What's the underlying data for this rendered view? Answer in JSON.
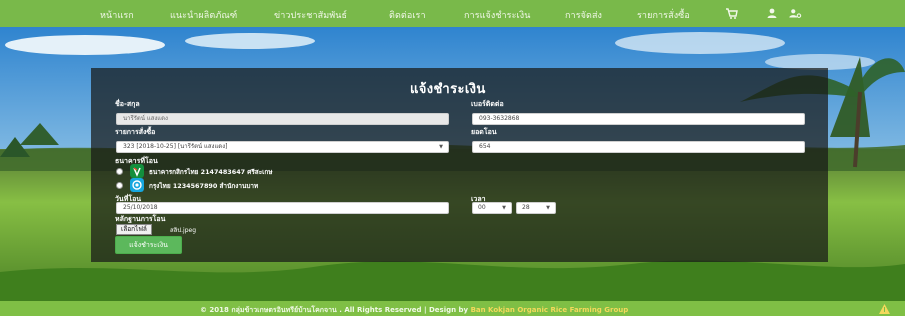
{
  "nav": {
    "items": [
      "หน้าแรก",
      "แนะนำผลิตภัณฑ์",
      "ข่าวประชาสัมพันธ์",
      "ติดต่อเรา",
      "การแจ้งชำระเงิน",
      "การจัดส่ง",
      "รายการสั่งซื้อ"
    ],
    "icons": [
      "cart-icon",
      "user-icon",
      "user-gear-icon"
    ]
  },
  "form": {
    "title": "แจ้งชำระเงิน",
    "name_label": "ชื่อ-สกุล",
    "name_value": "นารีรัตน์ แสงแดง",
    "phone_label": "เบอร์ติดต่อ",
    "phone_value": "093-3632868",
    "order_label": "รายการสั่งซื้อ",
    "order_value": "323 [2018-10-25] [นารีรัตน์ แสงแดง]",
    "amount_label": "ยอดโอน",
    "amount_value": "654",
    "bank_label": "ธนาคารที่โอน",
    "banks": [
      {
        "name": "ธนาคารกสิกรไทย 2147483647 ศรีสะเกษ",
        "icon": "kasikorn-bank-icon"
      },
      {
        "name": "กรุงไทย 1234567890 สำนักงานบาท",
        "icon": "krungthai-bank-icon"
      }
    ],
    "date_label": "วันที่โอน",
    "date_value": "25/10/2018",
    "time_label": "เวลา",
    "hour_value": "00",
    "minute_value": "28",
    "proof_label": "หลักฐานการโอน",
    "file_button": "เลือกไฟล์",
    "file_name": "สลิป.jpeg",
    "submit": "แจ้งชำระเงิน"
  },
  "footer": {
    "text": "© 2018 กลุ่มข้าวเกษตรอินทรีย์บ้านโคกจาน . All Rights Reserved | Design by",
    "highlight": "Ban Kokjan Organic Rice Farming Group"
  },
  "colors": {
    "nav": "#79b94a",
    "panel": "#171918",
    "submit": "#5cb85c",
    "footer": "#7fbf45",
    "footer_highlight": "#f4d95c"
  }
}
